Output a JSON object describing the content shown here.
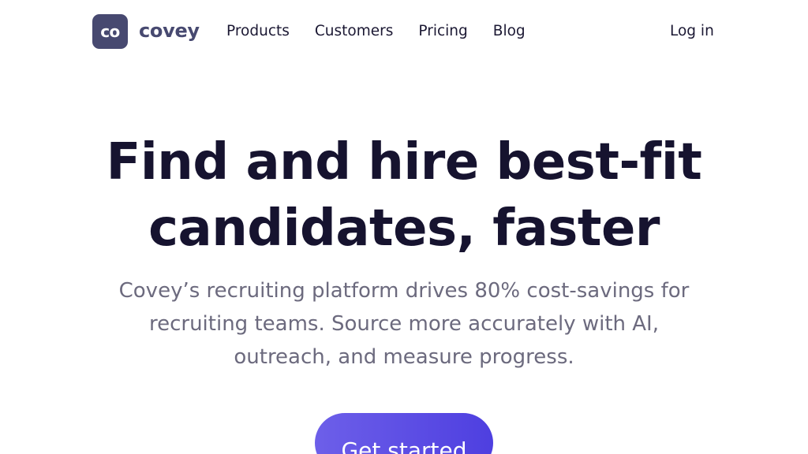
{
  "nav": {
    "logo_mark": "co",
    "logo_word": "covey",
    "links": [
      "Products",
      "Customers",
      "Pricing",
      "Blog"
    ],
    "login": "Log in"
  },
  "hero": {
    "title_line1": "Find and hire best-fit",
    "title_line2": "candidates, faster",
    "subtitle": "Covey’s recruiting platform drives 80% cost-savings for recruiting teams. Source more accurately with AI, outreach, and measure progress.",
    "cta": "Get started"
  },
  "colors": {
    "brand": "#474970",
    "text_dark": "#16132f",
    "text_muted": "#6c6a7e",
    "cta_start": "#6d5fe9",
    "cta_end": "#4e3fe0"
  }
}
